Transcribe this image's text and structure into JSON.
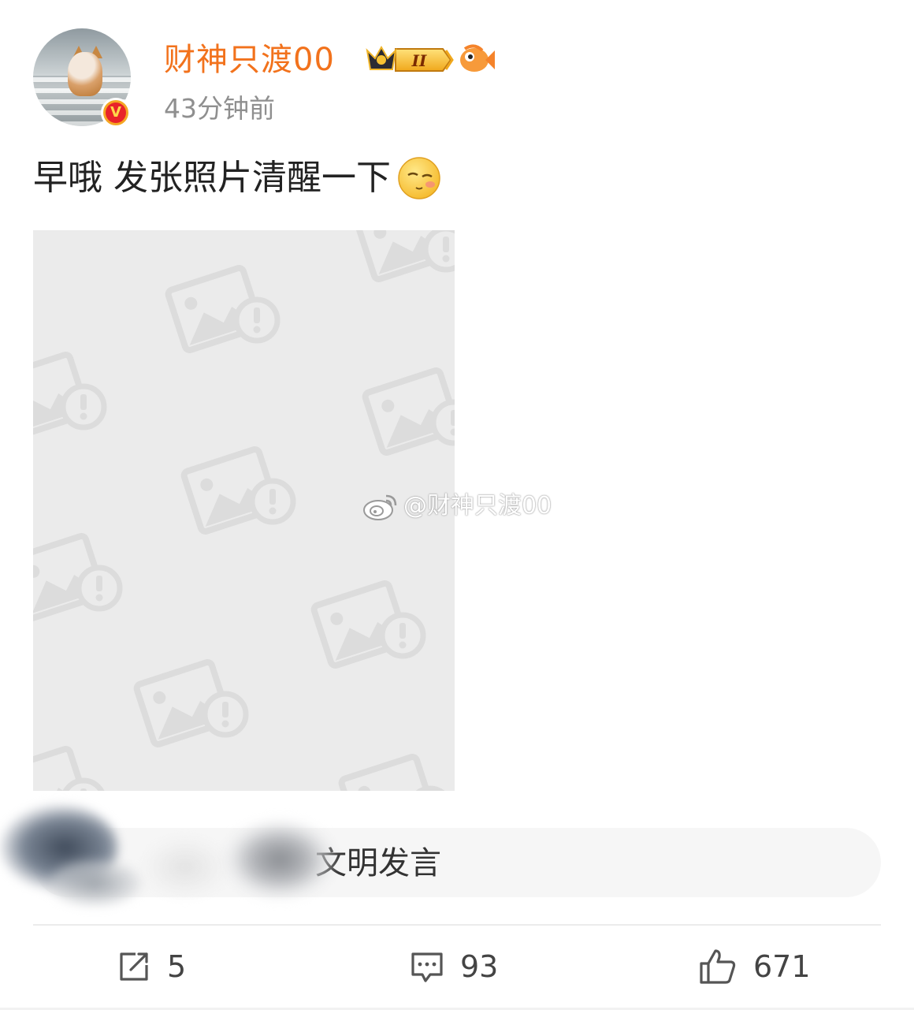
{
  "post": {
    "username": "财神只渡00",
    "time": "43分钟前",
    "text": "早哦 发张照片清醒一下",
    "verified_badge": "V",
    "level_badge": "II",
    "watermark": "@财神只渡00"
  },
  "comment_input": {
    "placeholder": "文明发言"
  },
  "actions": {
    "repost_count": "5",
    "comment_count": "93",
    "like_count": "671"
  },
  "icons": {
    "avatar": "cat-photo-avatar",
    "verified": "verified-v-badge",
    "crown": "crown-level-badge",
    "fish": "fish-icon",
    "emoji": "sleepy-face-emoji",
    "placeholder_image": "image-error-icon",
    "weibo": "weibo-logo",
    "repost": "repost-icon",
    "comment": "comment-icon",
    "like": "thumbs-up-icon"
  },
  "colors": {
    "username": "#f2721c",
    "time": "#8f8f8f",
    "image_placeholder": "#ebebeb"
  }
}
